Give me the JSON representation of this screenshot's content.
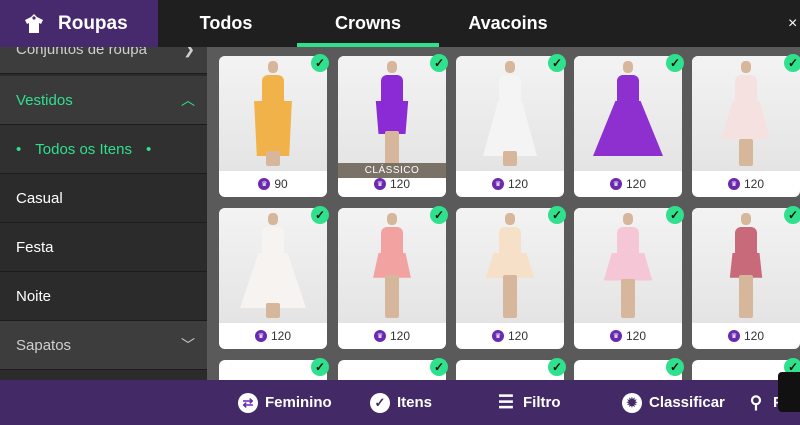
{
  "header": {
    "title": "Roupas",
    "icon": "hanger-shirt-icon"
  },
  "tabs": [
    {
      "label": "Todos",
      "active": false
    },
    {
      "label": "Crowns",
      "active": true
    },
    {
      "label": "Avacoins",
      "active": false
    }
  ],
  "close_label": "×",
  "sidebar": {
    "items": [
      {
        "label": "Conjuntos de roupa",
        "state": "dim"
      },
      {
        "label": "Vestidos",
        "state": "expanded"
      },
      {
        "label": "Todos os Itens",
        "state": "selected"
      },
      {
        "label": "Casual",
        "state": "normal"
      },
      {
        "label": "Festa",
        "state": "normal"
      },
      {
        "label": "Noite",
        "state": "normal"
      },
      {
        "label": "Sapatos",
        "state": "dim"
      }
    ]
  },
  "items": [
    {
      "price": "90",
      "color": "#f2b24a",
      "owned": true
    },
    {
      "price": "120",
      "color": "#8a2bd6",
      "owned": true,
      "badge": "CLÁSSICO"
    },
    {
      "price": "120",
      "color": "#f4f4f4",
      "owned": true
    },
    {
      "price": "120",
      "color": "#8e2fd0",
      "owned": true
    },
    {
      "price": "120",
      "color": "#f6e1e1",
      "owned": true
    },
    {
      "price": "120",
      "color": "#f7f3f0",
      "owned": true
    },
    {
      "price": "120",
      "color": "#f2a2a0",
      "owned": true
    },
    {
      "price": "120",
      "color": "#f7e0c8",
      "owned": true
    },
    {
      "price": "120",
      "color": "#f5c6d6",
      "owned": true
    },
    {
      "price": "120",
      "color": "#c86a7a",
      "owned": true
    }
  ],
  "bottom": {
    "gender_label": "Feminino",
    "items_label": "Itens",
    "filter_label": "Filtro",
    "sort_label": "Classificar",
    "search_label": "Pe"
  },
  "colors": {
    "accent": "#2fe08c",
    "purple": "#462a6d",
    "crown": "#6a2ab0"
  }
}
